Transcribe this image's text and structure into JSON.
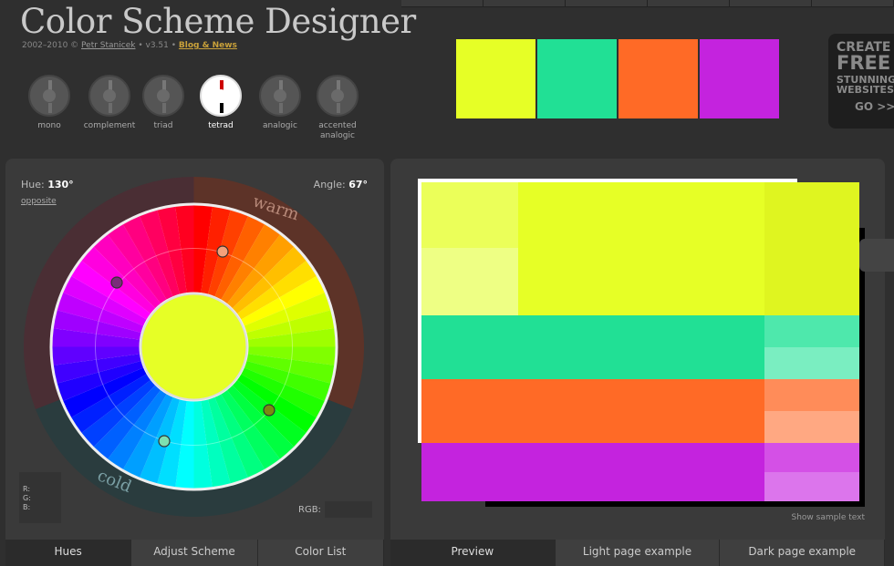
{
  "header": {
    "title": "Color Scheme Designer",
    "copyright_prefix": "2002–2010 ©",
    "author": "Petr Stanicek",
    "version": "• v3.51 •",
    "blog": "Blog & News"
  },
  "schemes": [
    {
      "label": "mono",
      "active": false
    },
    {
      "label": "complement",
      "active": false
    },
    {
      "label": "triad",
      "active": false
    },
    {
      "label": "tetrad",
      "active": true
    },
    {
      "label": "analogic",
      "active": false
    },
    {
      "label": "accented analogic",
      "active": false
    }
  ],
  "palette": [
    "#e6ff26",
    "#21e095",
    "#ff6a26",
    "#c423de"
  ],
  "ad": {
    "line1": "CREATE",
    "line2": "FREE",
    "line3": "STUNNING",
    "line4": "WEBSITES",
    "cta": "GO >>"
  },
  "wheel_panel": {
    "hue_label": "Hue:",
    "hue_value": "130°",
    "opposite": "opposite",
    "angle_label": "Angle:",
    "angle_value": "67°",
    "warm": "warm",
    "cold": "cold",
    "r_label": "R:",
    "g_label": "G:",
    "b_label": "B:",
    "rgb_label": "RGB:",
    "center_color": "#e6ff26"
  },
  "left_tabs": [
    "Hues",
    "Adjust Scheme",
    "Color List"
  ],
  "preview": {
    "show_sample": "Show sample text",
    "primary": [
      "#e6ff26",
      "#ebff59",
      "#eeff84",
      "#dff520"
    ],
    "secondary_a": [
      "#21e095",
      "#4ee8ac",
      "#7aeec1"
    ],
    "secondary_b": [
      "#ff6a26",
      "#ff8c59",
      "#ffa882"
    ],
    "complement": [
      "#c423de",
      "#d450e6",
      "#dc75ec"
    ]
  },
  "right_tabs": [
    "Preview",
    "Light page example",
    "Dark page example"
  ]
}
